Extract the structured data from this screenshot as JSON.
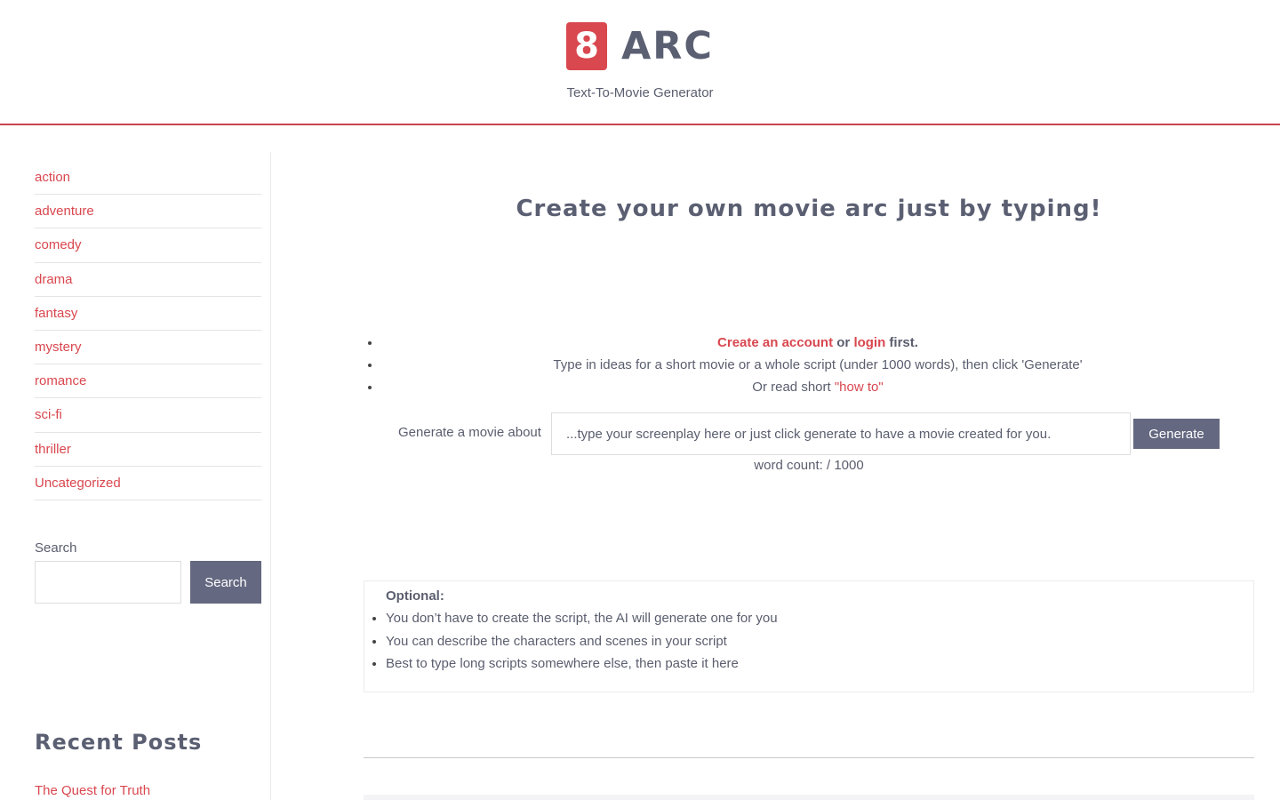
{
  "header": {
    "logo_char": "8",
    "site_title": "ARC",
    "tagline": "Text-To-Movie Generator"
  },
  "sidebar": {
    "categories": [
      "action",
      "adventure",
      "comedy",
      "drama",
      "fantasy",
      "mystery",
      "romance",
      "sci-fi",
      "thriller",
      "Uncategorized"
    ],
    "search": {
      "label": "Search",
      "button_label": "Search",
      "value": ""
    },
    "recent_posts": {
      "title": "Recent Posts",
      "items": [
        "The Quest for Truth"
      ]
    }
  },
  "main": {
    "title": "Create your own movie arc just by typing!",
    "instructions": {
      "create_account_link": "Create an account",
      "or_text": " or ",
      "login_link": "login",
      "first_text": " first.",
      "line2": "Type in ideas for a short movie or a whole script (under 1000 words), then click 'Generate'",
      "line3_prefix": "Or read short ",
      "howto_link": "\"how to\""
    },
    "generator": {
      "label": "Generate a movie about",
      "placeholder": "...type your screenplay here or just click generate to have a movie created for you.",
      "button_label": "Generate",
      "word_count": "word count: / 1000"
    },
    "optional": {
      "title": "Optional:",
      "items": [
        "You don’t have to create the script, the AI will generate one for you",
        "You can describe the characters and scenes in your script",
        "Best to type long scripts somewhere else, then paste it here"
      ]
    }
  },
  "colors": {
    "accent": "#d9474f",
    "button": "#646880",
    "heading": "#5b5f72"
  }
}
